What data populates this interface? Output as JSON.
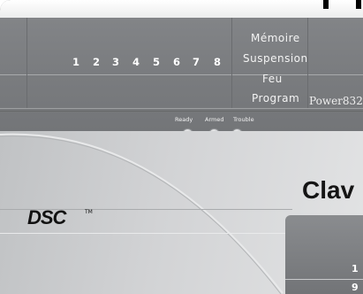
{
  "zones": [
    "1",
    "2",
    "3",
    "4",
    "5",
    "6",
    "7",
    "8"
  ],
  "labels": {
    "memoire": "Mémoire",
    "suspension": "Suspension",
    "feu": "Feu",
    "program": "Program"
  },
  "model": "Power832",
  "indicators": {
    "ready": "Ready",
    "armed": "Armed",
    "trouble": "Trouble"
  },
  "title_partial": "Clav",
  "brand": "DSC",
  "brand_tm": "TM",
  "keys": [
    "1",
    "9"
  ],
  "colors": {
    "display": "#7c7e81",
    "body": "#d2d3d5",
    "text_light": "#ffffff",
    "text_dark": "#141414"
  }
}
